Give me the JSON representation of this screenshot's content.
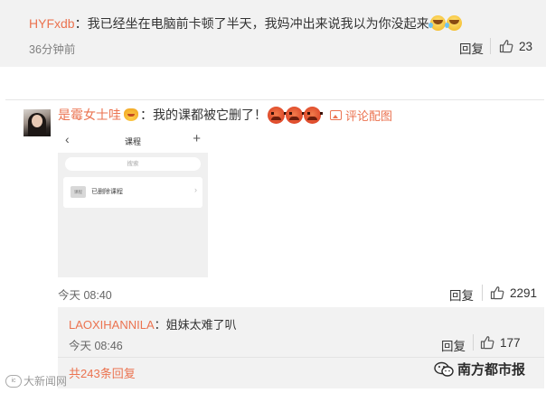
{
  "comment1": {
    "username": "HYFxdb",
    "text": "：我已经坐在电脑前卡顿了半天，我妈冲出来说我以为你没起来",
    "emojis": [
      "laugh-cry-emoji",
      "laugh-cry-emoji"
    ],
    "time": "36分钟前",
    "reply_label": "回复",
    "likes": "23"
  },
  "comment2": {
    "username": "是霉女士哇",
    "text": "：我的课都被它删了！",
    "emojis": [
      "angry-emoji",
      "angry-emoji",
      "angry-emoji"
    ],
    "image_link_label": "评论配图",
    "time": "今天 08:40",
    "reply_label": "回复",
    "likes": "2291",
    "image": {
      "back": "‹",
      "title": "课程",
      "add": "+",
      "search_placeholder": "搜索",
      "folder_badge": "课程",
      "row_label": "已删除课程",
      "chevron": "›"
    }
  },
  "reply": {
    "username": "LAOXIHANNILA",
    "text": "：姐妹太难了叭",
    "time": "今天 08:46",
    "reply_label": "回复",
    "likes": "177",
    "more_label": "共243条回复"
  },
  "watermark": {
    "left_logo": "ic",
    "left": "大新闻网",
    "right": "南方都市报"
  },
  "colors": {
    "username": "#eb7350",
    "card_bg": "#f2f2f2"
  }
}
